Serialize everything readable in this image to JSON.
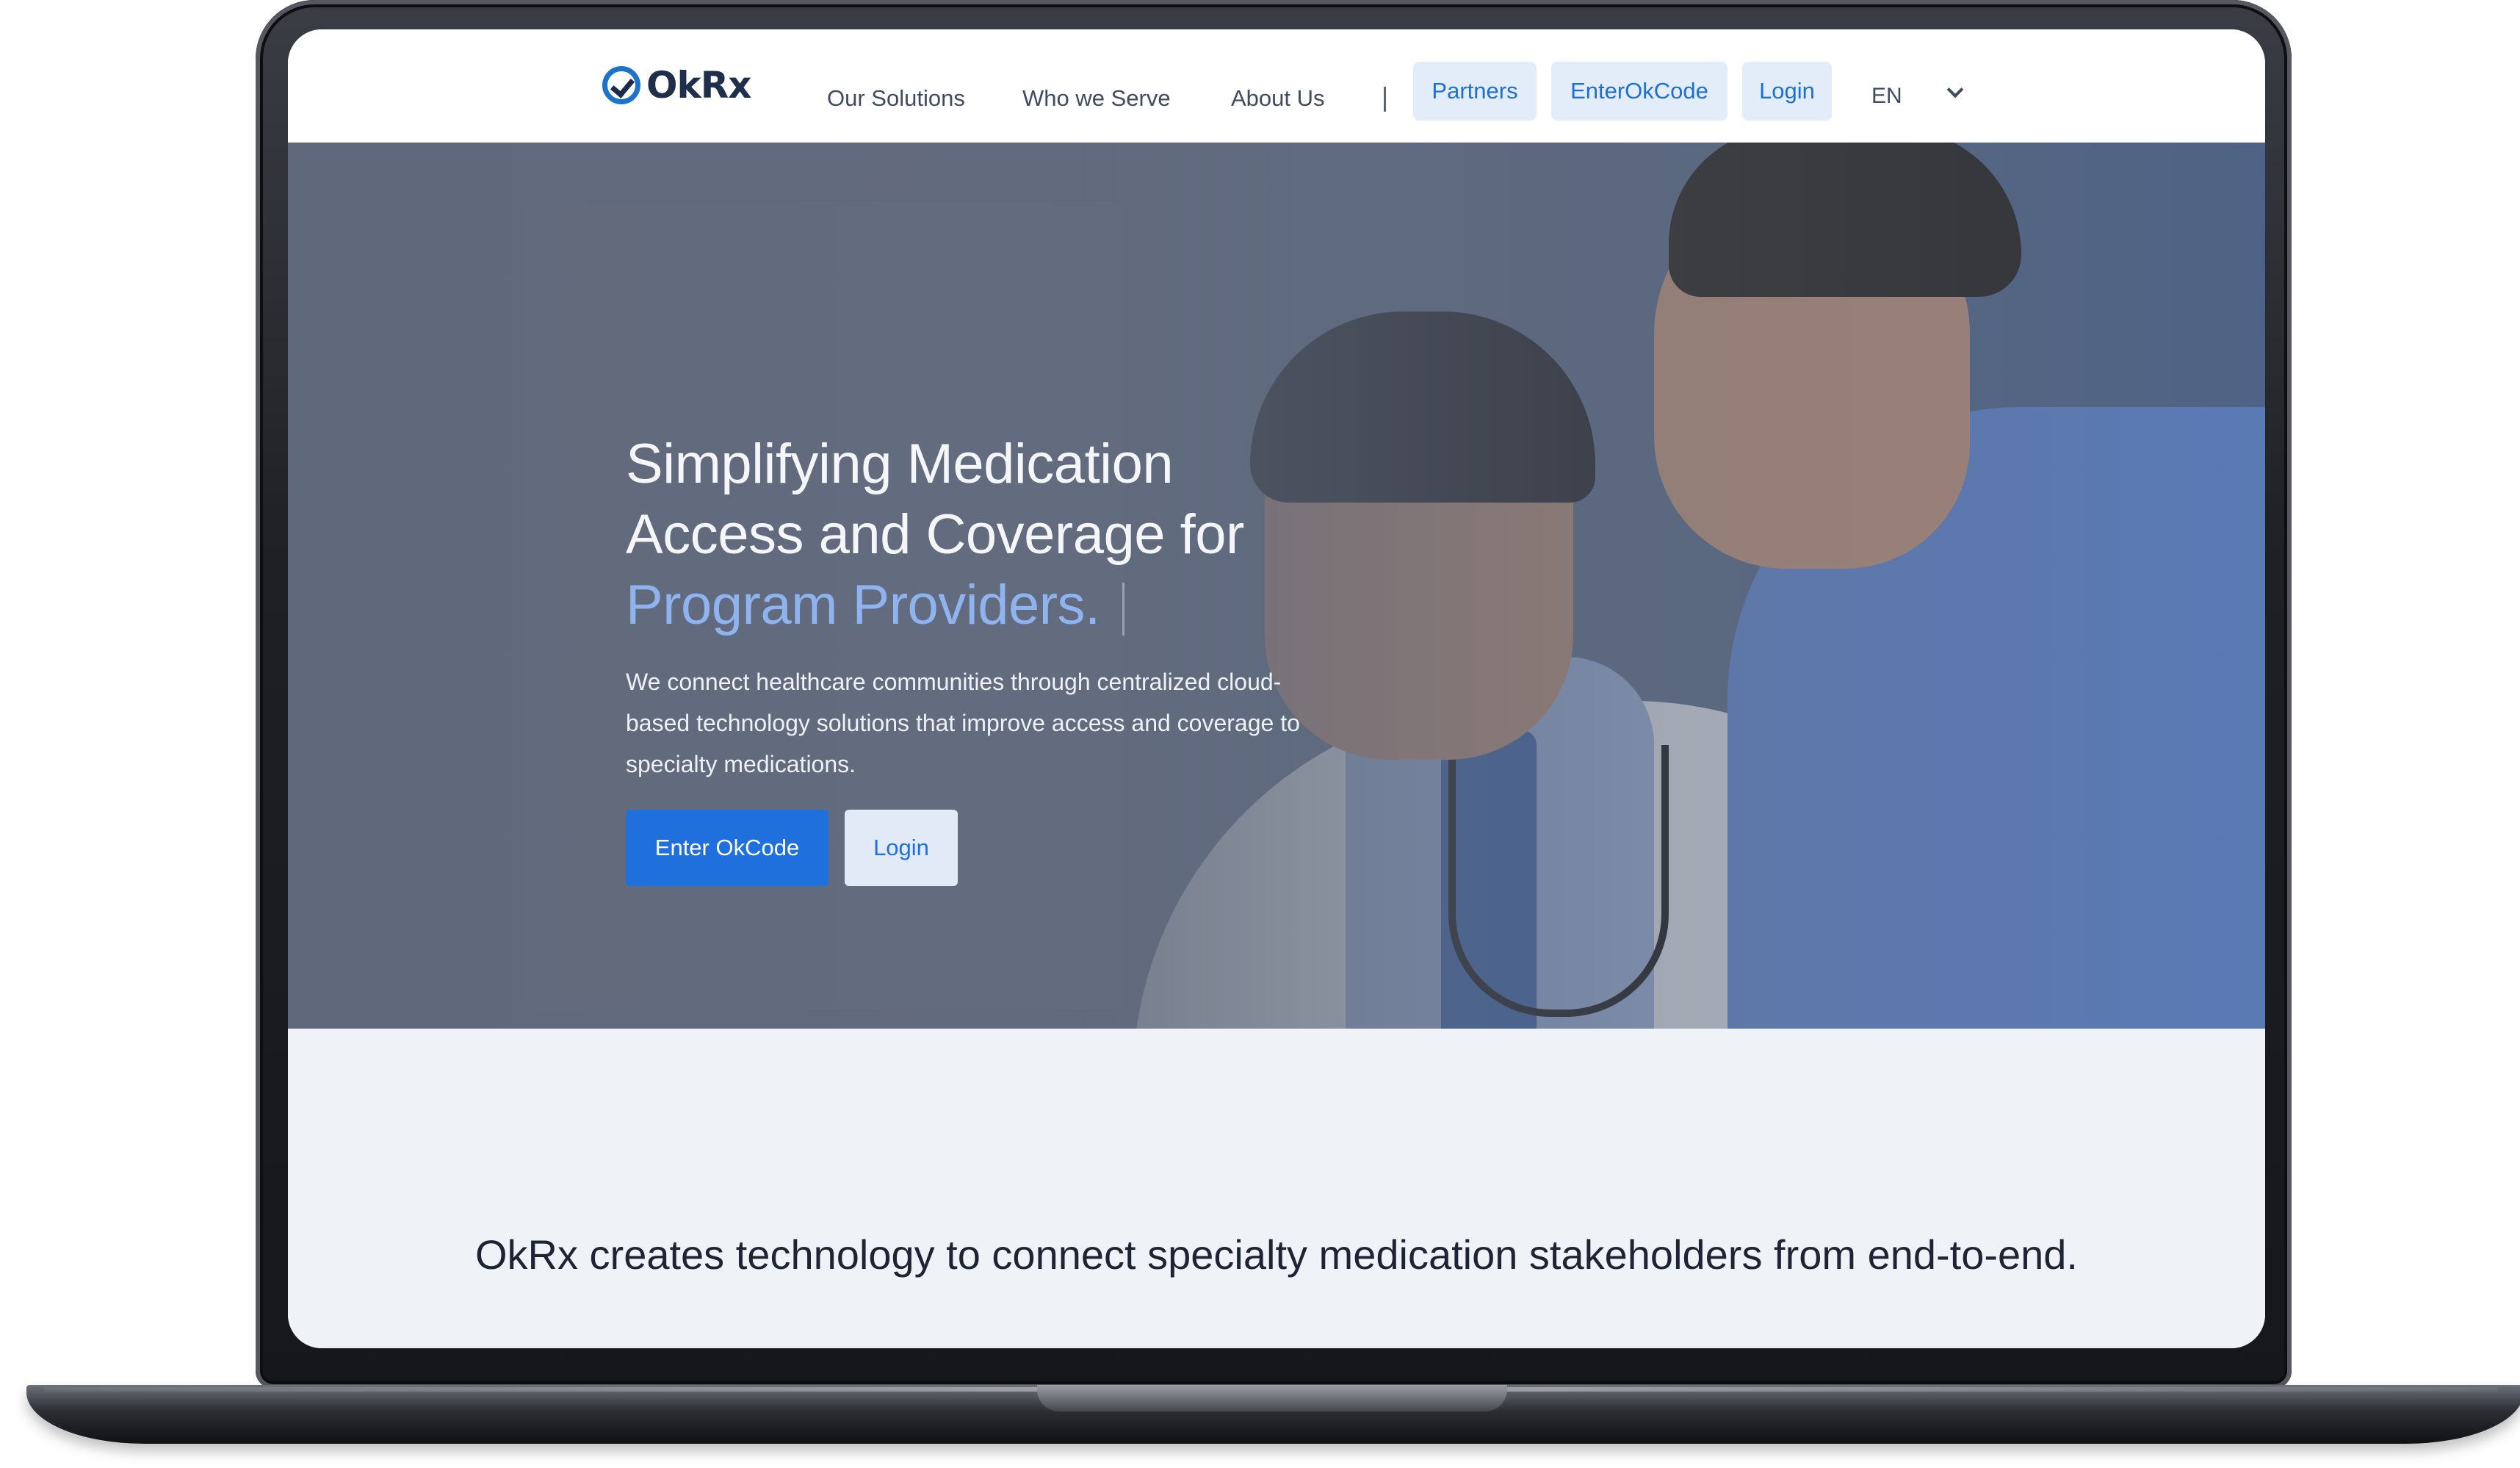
{
  "nav": {
    "brand": "OkRx",
    "links": [
      "Our Solutions",
      "Who we Serve",
      "About Us"
    ],
    "separator": "|",
    "buttons": [
      "Partners",
      "EnterOkCode",
      "Login"
    ],
    "language": "EN"
  },
  "hero": {
    "title_line1": "Simplifying Medication",
    "title_line2": "Access and Coverage for",
    "title_accent": "Program Providers.",
    "description": "We connect healthcare communities through centralized cloud-based technology solutions that improve access and coverage to specialty medications.",
    "primary_button": "Enter OkCode",
    "secondary_button": "Login"
  },
  "section": {
    "tagline": "OkRx creates technology to connect specialty medication stakeholders from end-to-end."
  },
  "colors": {
    "accent": "#1f6fdc",
    "accent_light": "#e2eaf8",
    "hero_accent_text": "#8fb3ee",
    "section_bg": "#eff3f8"
  },
  "icons": [
    "check-circle-icon",
    "chevron-down-icon"
  ]
}
